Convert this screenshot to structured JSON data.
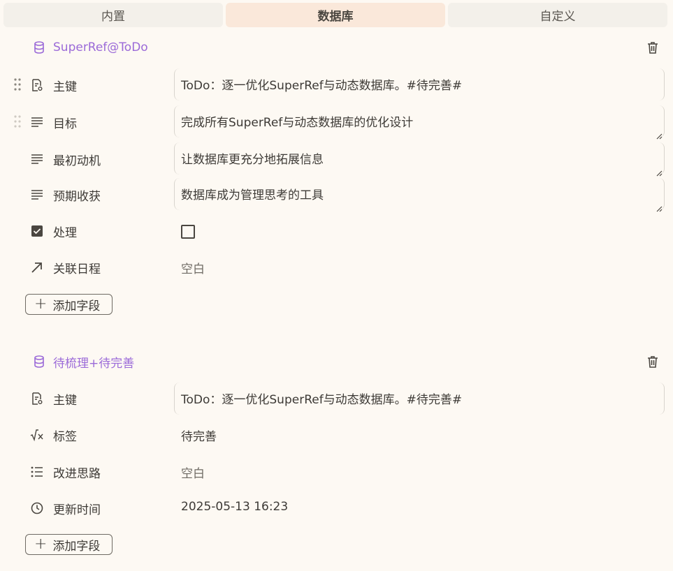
{
  "tabs": [
    {
      "label": "内置",
      "active": false
    },
    {
      "label": "数据库",
      "active": true
    },
    {
      "label": "自定义",
      "active": false
    }
  ],
  "databases": [
    {
      "title": "SuperRef@ToDo",
      "fields": [
        {
          "icon": "primary-key-icon",
          "label": "主键",
          "value": "ToDo：逐一优化SuperRef与动态数据库。#待完善#"
        },
        {
          "icon": "text-icon",
          "label": "目标",
          "value": "完成所有SuperRef与动态数据库的优化设计"
        },
        {
          "icon": "text-icon",
          "label": "最初动机",
          "value": "让数据库更充分地拓展信息"
        },
        {
          "icon": "text-icon",
          "label": "预期收获",
          "value": "数据库成为管理思考的工具"
        },
        {
          "icon": "checkbox-icon",
          "label": "处理",
          "checked": false
        },
        {
          "icon": "relation-arrow-icon",
          "label": "关联日程",
          "value": "空白"
        }
      ],
      "add_field_label": "添加字段"
    },
    {
      "title": "待梳理+待完善",
      "fields": [
        {
          "icon": "primary-key-icon",
          "label": "主键",
          "value": "ToDo：逐一优化SuperRef与动态数据库。#待完善#"
        },
        {
          "icon": "formula-icon",
          "label": "标签",
          "value": "待完善"
        },
        {
          "icon": "list-icon",
          "label": "改进思路",
          "value": "空白"
        },
        {
          "icon": "clock-icon",
          "label": "更新时间",
          "value": "2025-05-13 16:23"
        }
      ],
      "add_field_label": "添加字段"
    }
  ],
  "colors": {
    "accent": "#9b6ad8",
    "active_tab": "#fae8da",
    "background": "#fdf9f3"
  }
}
